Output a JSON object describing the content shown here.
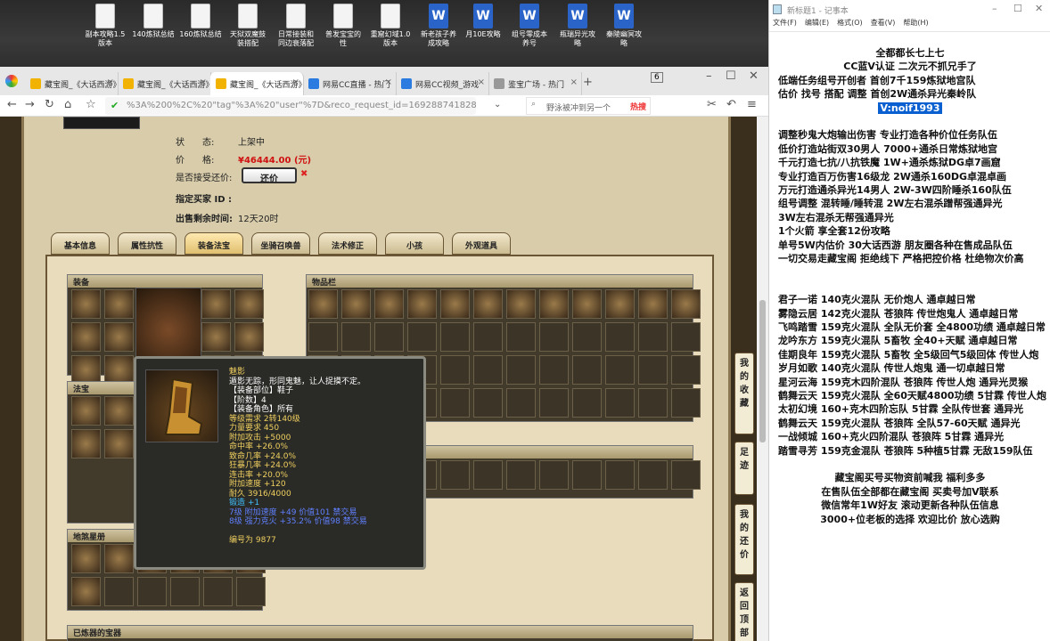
{
  "desktop": {
    "icons": [
      {
        "label": "副本攻略1.5\n版本",
        "kind": "file"
      },
      {
        "label": "140炼狱总结",
        "kind": "file"
      },
      {
        "label": "160炼狱总结",
        "kind": "file"
      },
      {
        "label": "天狱双魔鼓\n装搭配",
        "kind": "file"
      },
      {
        "label": "日常接装和\n同边衰落配",
        "kind": "file"
      },
      {
        "label": "普发宝宝的\n性",
        "kind": "file"
      },
      {
        "label": "重窟幻域1.0\n版本",
        "kind": "file"
      },
      {
        "label": "新老孩子养\n成攻略",
        "kind": "word"
      },
      {
        "label": "月10E攻略",
        "kind": "word"
      },
      {
        "label": "组号零成本\n养号",
        "kind": "word"
      },
      {
        "label": "瓶瑞异光攻\n略",
        "kind": "word"
      },
      {
        "label": "秦陵幽冥攻\n略",
        "kind": "word"
      }
    ]
  },
  "browser": {
    "tabs": [
      {
        "title": "藏宝阁_《大话西游》"
      },
      {
        "title": "藏宝阁_《大话西游》"
      },
      {
        "title": "藏宝阁_《大话西游》"
      },
      {
        "title": "网易CC直播 - 热门"
      },
      {
        "title": "网易CC视频_游戏"
      },
      {
        "title": "鉴宝广场 - 热门"
      }
    ],
    "tab_count": "6",
    "url": "%3A%200%2C%20\"tag\"%3A%20\"user\"%7D&reco_request_id=1692887418286zOOdG",
    "search": "野泳被冲到另一个",
    "hot_label": "热搜"
  },
  "item": {
    "status_label": "状　　态:",
    "status_value": "上架中",
    "price_label": "价　　格:",
    "price_value": "¥46444.00 (元)",
    "bargain_label": "是否接受还价:",
    "bargain_button": "还价",
    "buyer_label": "指定买家 ID :",
    "buyer_value": "",
    "time_label": "出售剩余时间:",
    "time_value": "12天20时"
  },
  "tabs": [
    "基本信息",
    "属性抗性",
    "装备法宝",
    "坐骑召唤兽",
    "法术修正",
    "小孩",
    "外观道具"
  ],
  "sections": {
    "equip": "装备",
    "bag": "物品栏",
    "magic": "法宝",
    "ground": "地煞星册",
    "bottom": "已炼器的宝器"
  },
  "tooltip": {
    "lines": [
      {
        "t": "魅影",
        "c": "#f0d060"
      },
      {
        "t": "遁影无踪，形同鬼魅，让人捉摸不定。",
        "c": "#fff"
      },
      {
        "t": "【装备部位】鞋子",
        "c": "#fff"
      },
      {
        "t": "【阶数】4",
        "c": "#fff"
      },
      {
        "t": "【装备角色】所有",
        "c": "#fff"
      },
      {
        "t": "等级需求 2转140级",
        "c": "#f0d060"
      },
      {
        "t": "力量要求 450",
        "c": "#f0d060"
      },
      {
        "t": "附加攻击 +5000",
        "c": "#f0d060"
      },
      {
        "t": "命中率 +26.0%",
        "c": "#f0d060"
      },
      {
        "t": "致命几率 +24.0%",
        "c": "#f0d060"
      },
      {
        "t": "狂暴几率 +24.0%",
        "c": "#f0d060"
      },
      {
        "t": "连击率 +20.0%",
        "c": "#f0d060"
      },
      {
        "t": "附加速度 +120",
        "c": "#f0d060"
      },
      {
        "t": "耐久 3916/4000",
        "c": "#f0d060"
      },
      {
        "t": "锻造 +1",
        "c": "#40c0ff"
      },
      {
        "t": "7级 附加速度 +49 价值101 禁交易",
        "c": "#6080ff"
      },
      {
        "t": "8级 强力克火 +35.2% 价值98 禁交易",
        "c": "#6080ff"
      },
      {
        "t": "",
        "c": "#fff"
      },
      {
        "t": "编号为 9877",
        "c": "#f0d060"
      }
    ]
  },
  "sidebar": [
    "我的收藏",
    "足迹",
    "我的还价",
    "返回顶部"
  ],
  "notepad": {
    "title": "新标题1 - 记事本",
    "menu": [
      "文件(F)",
      "编辑(E)",
      "格式(O)",
      "查看(V)",
      "帮助(H)"
    ],
    "lines": [
      "全都都长七上七",
      "CC蓝V认证 二次元不抓兄手了",
      "低端任务组号开创者          首创7千159炼狱地宫队",
      "估价 找号 搭配 调整          首创2W通杀异光秦岭队",
      "V:noif1993",
      "",
      "调整秒鬼大炮输出伤害          专业打造各种价位任务队伍",
      "低价打造站街双30男人          7000+通杀日常炼狱地宫",
      "千元打造七抗/八抗铁魔          1W+通杀炼狱DG卓7画窟",
      "专业打造百万伤害16级龙          2W通杀160DG卓混卓画",
      "万元打造通杀异光14男人          2W-3W四阶睡杀160队伍",
      "组号调整 混转睡/睡转混          2W左右混杀蹭帮强通异光",
      "                                      3W左右混杀无帮强通异光",
      "1个火箭 享全套12份攻略",
      "单号5W内估价 30大话西游          朋友圈各种在售成品队伍",
      "一切交易走藏宝阁 拒绝线下     严格把控价格 杜绝物次价高",
      "",
      "",
      "君子一诺 140克火混队 无价炮人 通卓越日常",
      "雾隐云居 142克火混队 苍狼阵 传世炮鬼人 通卓越日常",
      "飞鸣踏雪 159克火混队 全队无价套 全4800功绩 通卓越日常",
      "龙吟东方 159克火混队 5畜牧 全40+天赋 通卓越日常",
      "佳期良年 159克火混队 5畜牧 全5级回气5级回体 传世人炮",
      "岁月如歌 140克火混队 传世人炮鬼 通一切卓越日常",
      "星河云海 159克木四阶混队 苍狼阵 传世人炮 通异光灵猴",
      "鹤舞云天 159克火混队 全60天赋4800功绩 5甘霖 传世人炮",
      "太初幻境 160+克木四阶忘队 5甘霖 全队传世套 通异光",
      "鹤舞云天 159克火混队 苍狼阵 全队57-60天赋 通异光",
      "一战倾城 160+克火四阶混队 苍狼阵 5甘霖 通异光",
      "踏雪寻芳 159克金混队 苍狼阵 5种植5甘霖 无敌159队伍",
      "",
      "藏宝阁买号买物资前喊我 福利多多",
      "在售队伍全部都在藏宝阁 买卖号加V联系",
      "微信常年1W好友 滚动更新各种队伍信息",
      "3000+位老板的选择 欢迎比价 放心选购"
    ]
  }
}
